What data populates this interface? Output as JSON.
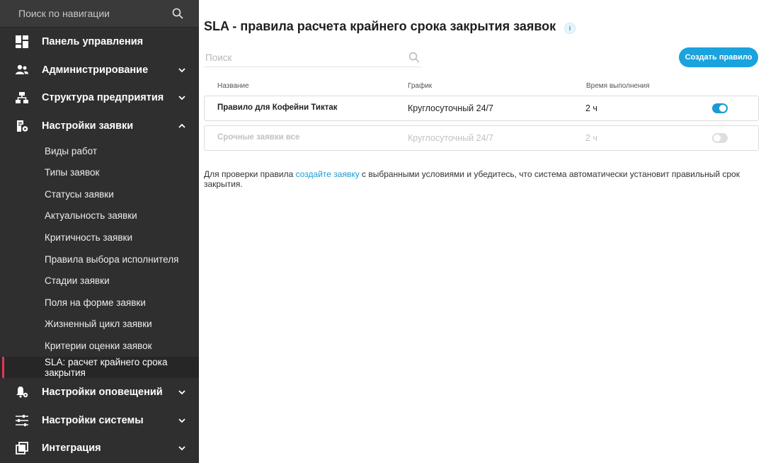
{
  "sidebar": {
    "search_placeholder": "Поиск по навигации",
    "groups": [
      {
        "label": "Панель управления",
        "icon": "dashboard-icon"
      },
      {
        "label": "Администрирование",
        "icon": "users-icon"
      },
      {
        "label": "Структура предприятия",
        "icon": "org-structure-icon"
      },
      {
        "label": "Настройки заявки",
        "icon": "request-settings-icon"
      },
      {
        "label": "Настройки оповещений",
        "icon": "bell-settings-icon"
      },
      {
        "label": "Настройки системы",
        "icon": "sliders-icon"
      },
      {
        "label": "Интеграция",
        "icon": "integration-icon"
      }
    ],
    "sub_items": [
      "Виды работ",
      "Типы заявок",
      "Статусы заявки",
      "Актуальность заявки",
      "Критичность заявки",
      "Правила выбора исполнителя",
      "Стадии заявки",
      "Поля на форме заявки",
      "Жизненный цикл заявки",
      "Критерии оценки заявок",
      "SLA: расчет крайнего срока закрытия"
    ],
    "active_sub_item": "SLA: расчет крайнего срока закрытия"
  },
  "main": {
    "title": "SLA - правила расчета крайнего срока закрытия заявок",
    "search_placeholder": "Поиск",
    "create_button": "Создать правило",
    "columns": [
      "Название",
      "График",
      "Время выполнения"
    ],
    "rows": [
      {
        "name": "Правило для Кофейни Тиктак",
        "schedule": "Круглосуточный 24/7",
        "duration": "2 ч",
        "enabled": true
      },
      {
        "name": "Срочные заявки все",
        "schedule": "Круглосуточный 24/7",
        "duration": "2 ч",
        "enabled": false
      }
    ],
    "help": {
      "before": "Для проверки правила ",
      "link": "создайте заявку",
      "after": " с выбранными условиями и убедитесь, что система автоматически установит правильный срок закрытия."
    },
    "accent_color": "#1a9ad6",
    "active_marker_color": "#e2354f"
  }
}
